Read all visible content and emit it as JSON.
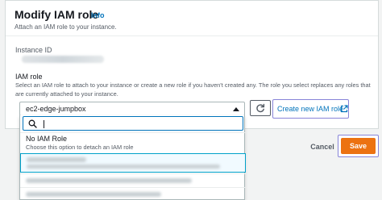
{
  "header": {
    "title": "Modify IAM role",
    "info_label": "Info",
    "subtitle": "Attach an IAM role to your instance."
  },
  "instance": {
    "label": "Instance ID",
    "value_redacted": true
  },
  "iam_role": {
    "label": "IAM role",
    "description": "Select an IAM role to attach to your instance or create a new role if you haven't created any. The role you select replaces any roles that are currently attached to your instance.",
    "selected_value": "ec2-edge-jumpbox",
    "search_placeholder": "",
    "search_value": "",
    "options": [
      {
        "title": "No IAM Role",
        "description": "Choose this option to detach an IAM role"
      }
    ],
    "redacted_option_count": 3
  },
  "actions": {
    "create_role_label": "Create new IAM role",
    "cancel_label": "Cancel",
    "save_label": "Save"
  },
  "colors": {
    "accent": "#0073bb",
    "primary_button": "#ec7211",
    "highlight_frame": "#8884d8",
    "selected_option_bg": "#f1faff"
  },
  "icons": [
    "refresh-icon",
    "external-link-icon",
    "search-icon",
    "caret-up-icon"
  ]
}
